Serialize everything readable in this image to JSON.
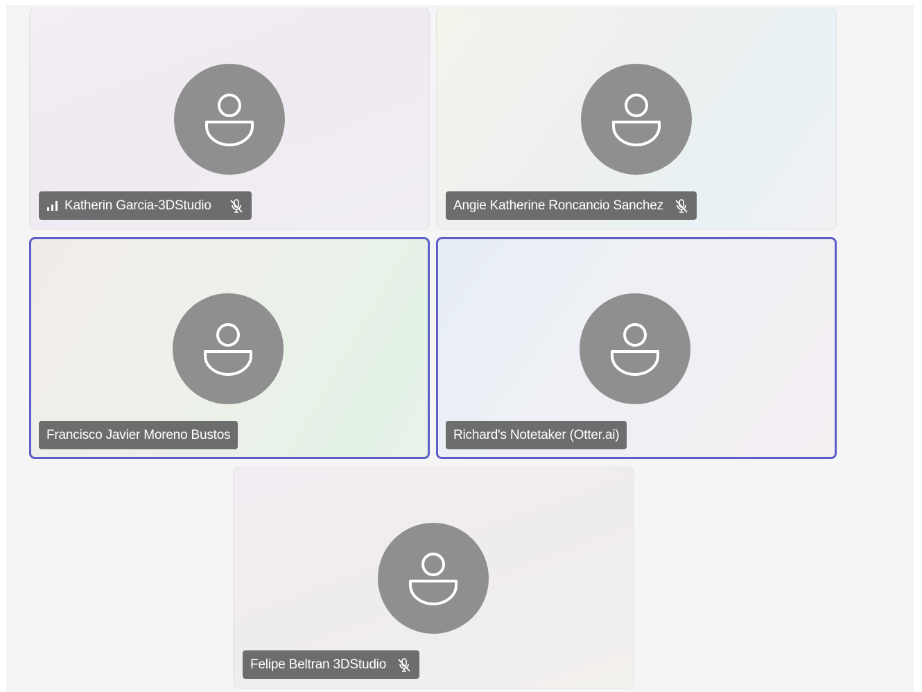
{
  "participants": [
    {
      "name": "Katherin Garcia-3DStudio",
      "muted": true,
      "signal_indicator": true,
      "speaking": false
    },
    {
      "name": "Angie Katherine Roncancio Sanchez",
      "muted": true,
      "signal_indicator": false,
      "speaking": false
    },
    {
      "name": "Francisco Javier Moreno Bustos",
      "muted": false,
      "signal_indicator": false,
      "speaking": true
    },
    {
      "name": "Richard's Notetaker (Otter.ai)",
      "muted": false,
      "signal_indicator": false,
      "speaking": true
    },
    {
      "name": "Felipe Beltran 3DStudio",
      "muted": true,
      "signal_indicator": false,
      "speaking": false
    }
  ],
  "icons": {
    "avatar": "person-icon",
    "signal": "signal-bars-icon",
    "muted": "mic-off-icon"
  },
  "colors": {
    "speaking_border": "#5b5fc7",
    "avatar_bg": "#8f8f8f",
    "nameplate_bg": "#626262"
  }
}
